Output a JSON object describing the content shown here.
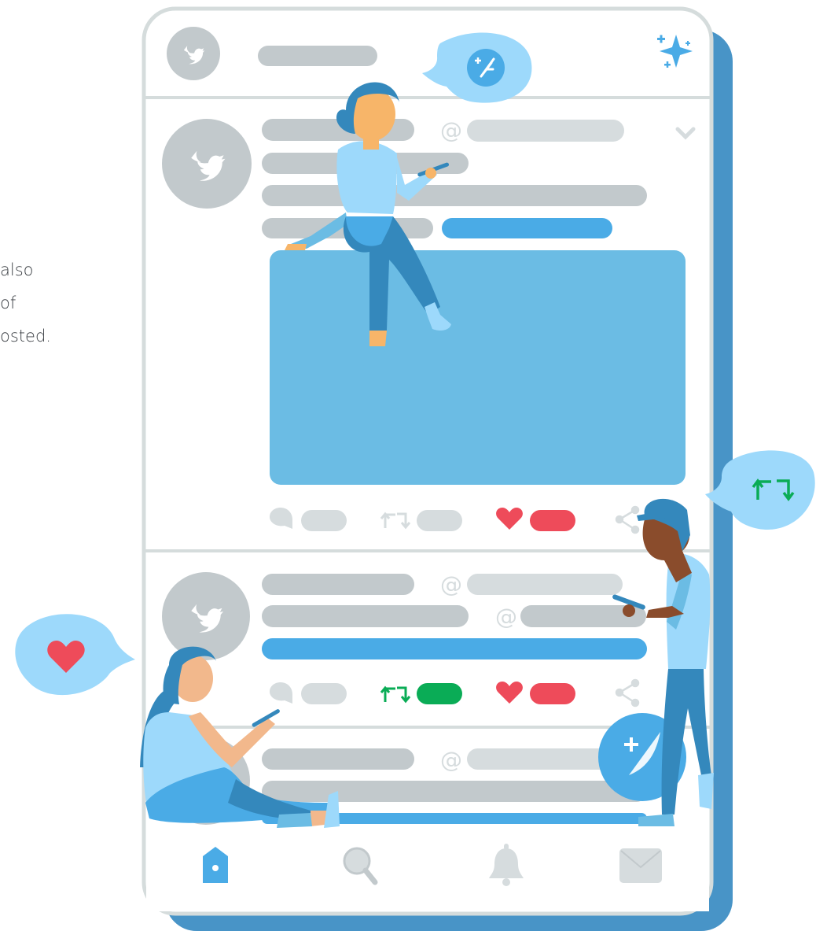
{
  "side_text": {
    "line1": "also",
    "line2": "of",
    "line3": "osted."
  },
  "mentions": {
    "at_symbol": "@"
  },
  "bubbles": {
    "compose": "compose-feather-icon",
    "sparkle": "sparkle-icon",
    "retweet": "retweet-icon",
    "like": "heart-icon"
  },
  "colors": {
    "primary_blue": "#4aabe6",
    "light_blue": "#9dd9fb",
    "media_blue": "#6bbce4",
    "shadow_blue": "#4894c7",
    "placeholder_gray": "#c2c9cc",
    "light_gray": "#d6dcde",
    "like_red": "#ee4b5a",
    "retweet_green": "#0aac56",
    "frame_border": "#d5dcdc"
  },
  "tweets": [
    {
      "retweeted": false,
      "liked": true
    },
    {
      "retweeted": true,
      "liked": true
    },
    {
      "retweeted": false,
      "liked": false
    }
  ],
  "bottom_nav": [
    "home-icon",
    "search-icon",
    "notifications-bell-icon",
    "messages-envelope-icon"
  ]
}
